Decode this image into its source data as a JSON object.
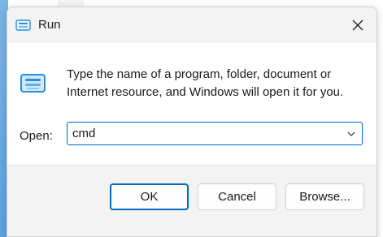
{
  "dialog": {
    "title": "Run",
    "title_icon": "run-icon",
    "close_icon": "close-icon"
  },
  "content": {
    "icon": "run-icon",
    "description_line1": "Type the name of a program, folder, document or",
    "description_line2": "Internet resource, and Windows will open it for you.",
    "open_label": "Open:",
    "open_value": "cmd",
    "dropdown_icon": "chevron-down-icon"
  },
  "buttons": {
    "ok": "OK",
    "cancel": "Cancel",
    "browse": "Browse..."
  },
  "colors": {
    "accent": "#0067c0",
    "titlebar": "#f3f3f3",
    "footer": "#f3f3f3",
    "icon_blue": "#2a8fd6"
  }
}
